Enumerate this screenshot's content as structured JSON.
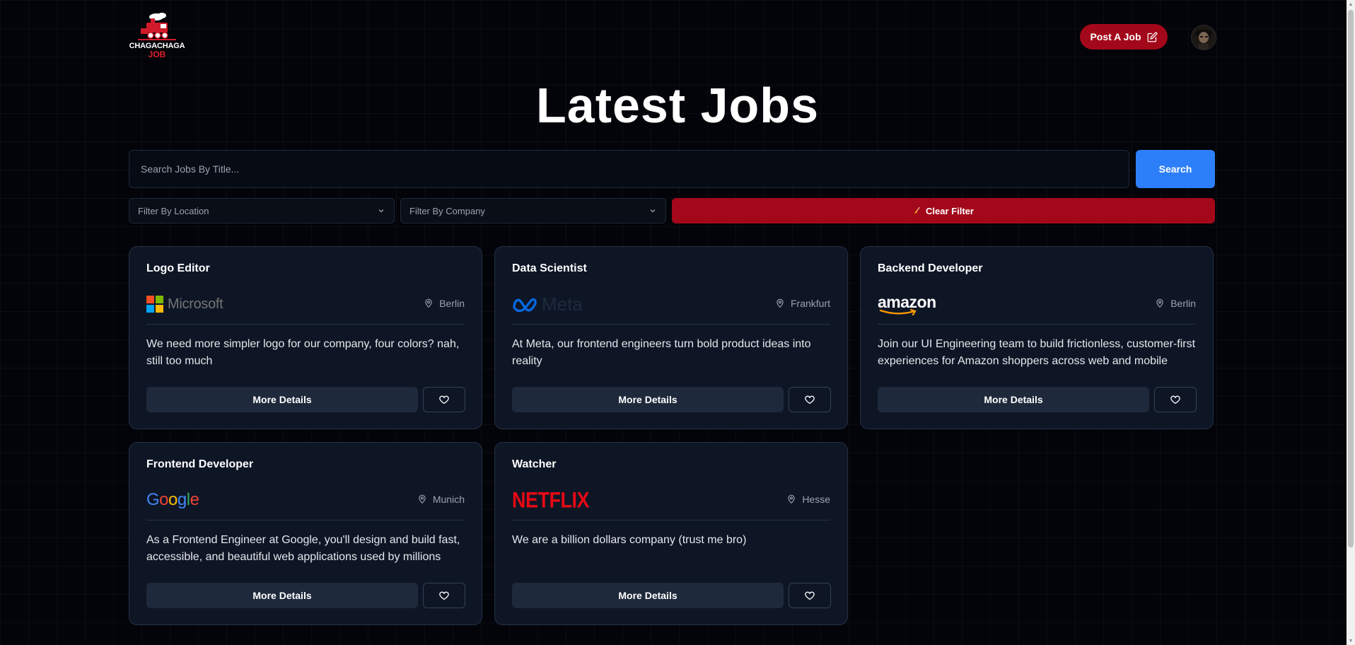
{
  "header": {
    "logo_top_text": "CHAGACHAGA",
    "logo_bottom_text": "JOB",
    "post_job_label": "Post A Job",
    "avatar_alt": "user-avatar"
  },
  "main": {
    "title": "Latest Jobs",
    "search": {
      "placeholder": "Search Jobs By Title...",
      "value": "",
      "button_label": "Search"
    },
    "filters": {
      "location_placeholder": "Filter By Location",
      "company_placeholder": "Filter By Company",
      "clear_label": "Clear Filter"
    }
  },
  "jobs": [
    {
      "title": "Logo Editor",
      "company": "Microsoft",
      "location": "Berlin",
      "description": "We need more simpler logo for our company, four colors? nah, still too much",
      "details_label": "More Details"
    },
    {
      "title": "Data Scientist",
      "company": "Meta",
      "location": "Frankfurt",
      "description": "At Meta, our frontend engineers turn bold product ideas into reality",
      "details_label": "More Details"
    },
    {
      "title": "Backend Developer",
      "company": "amazon",
      "location": "Berlin",
      "description": "Join our UI Engineering team to build frictionless, customer-first experiences for Amazon shoppers across web and mobile",
      "details_label": "More Details"
    },
    {
      "title": "Frontend Developer",
      "company": "Google",
      "location": "Munich",
      "description": "As a Frontend Engineer at Google, you'll design and build fast, accessible, and beautiful web applications used by millions",
      "details_label": "More Details"
    },
    {
      "title": "Watcher",
      "company": "NETFLIX",
      "location": "Hesse",
      "description": "We are a billion dollars company (trust me bro)",
      "details_label": "More Details"
    }
  ],
  "colors": {
    "background": "#020409",
    "card_bg": "#0e1626",
    "accent_red": "#a3081a",
    "accent_blue": "#2d7ff9",
    "netflix_red": "#e50914"
  }
}
